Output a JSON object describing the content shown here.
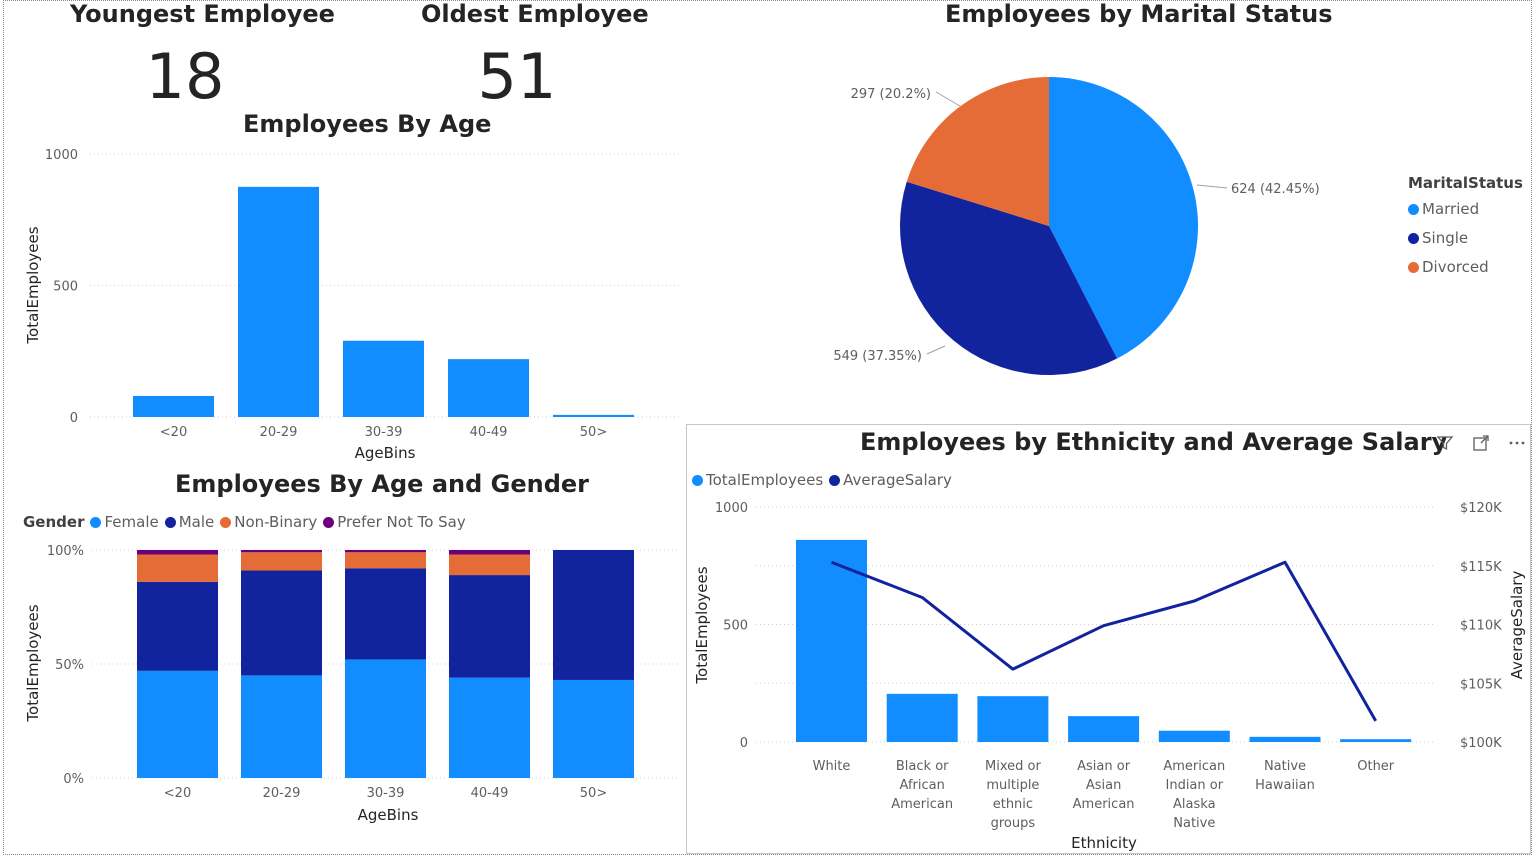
{
  "cards": [
    {
      "label": "Youngest Employee",
      "value": "18"
    },
    {
      "label": "Oldest Employee",
      "value": "51"
    }
  ],
  "charts": {
    "age": {
      "title": "Employees By Age",
      "xlabel": "AgeBins",
      "ylabel": "TotalEmployees",
      "ticks": [
        "0",
        "500",
        "1000"
      ]
    },
    "gender": {
      "title": "Employees By Age and Gender",
      "legend_title": "Gender",
      "legend": [
        "Female",
        "Male",
        "Non-Binary",
        "Prefer Not To Say"
      ],
      "xlabel": "AgeBins",
      "ylabel": "TotalEmployees",
      "ticks": [
        "0%",
        "50%",
        "100%"
      ]
    },
    "marital": {
      "title": "Employees by Marital Status",
      "legend_title": "MaritalStatus",
      "legend": [
        "Married",
        "Single",
        "Divorced"
      ],
      "labels": [
        "624 (42.45%)",
        "549 (37.35%)",
        "297 (20.2%)"
      ]
    },
    "ethnicity": {
      "title": "Employees by Ethnicity and Average Salary",
      "legend": [
        "TotalEmployees",
        "AverageSalary"
      ],
      "xlabel": "Ethnicity",
      "ylabel_left": "TotalEmployees",
      "ylabel_right": "AverageSalary",
      "left_ticks": [
        "0",
        "500",
        "1000"
      ],
      "right_ticks": [
        "$100K",
        "$105K",
        "$110K",
        "$115K",
        "$120K"
      ],
      "category_lines": [
        [
          "White"
        ],
        [
          "Black or",
          "African",
          "American"
        ],
        [
          "Mixed or",
          "multiple",
          "ethnic",
          "groups"
        ],
        [
          "Asian or",
          "Asian",
          "American"
        ],
        [
          "American",
          "Indian or",
          "Alaska",
          "Native"
        ],
        [
          "Native",
          "Hawaiian"
        ],
        [
          "Other"
        ]
      ]
    }
  },
  "colors": {
    "blue": "#118DFF",
    "navy": "#12239E",
    "orange": "#E66C37",
    "purple": "#6B007B",
    "grid": "#d0d0d0",
    "axis_text": "#605e5c",
    "line": "#12239E"
  },
  "icons": [
    "filter-icon",
    "focus-mode-icon",
    "more-options-icon"
  ],
  "chart_data": [
    {
      "type": "bar",
      "title": "Employees By Age",
      "categories": [
        "<20",
        "20-29",
        "30-39",
        "40-49",
        "50>"
      ],
      "values": [
        80,
        875,
        290,
        220,
        8
      ],
      "xlabel": "AgeBins",
      "ylabel": "TotalEmployees",
      "ylim": [
        0,
        1000
      ],
      "grid": true
    },
    {
      "type": "bar",
      "stacked_percent": true,
      "title": "Employees By Age and Gender",
      "categories": [
        "<20",
        "20-29",
        "30-39",
        "40-49",
        "50>"
      ],
      "series": [
        {
          "name": "Female",
          "values": [
            47,
            45,
            52,
            44,
            43
          ]
        },
        {
          "name": "Male",
          "values": [
            39,
            46,
            40,
            45,
            57
          ]
        },
        {
          "name": "Non-Binary",
          "values": [
            12,
            8,
            7,
            9,
            0
          ]
        },
        {
          "name": "Prefer Not To Say",
          "values": [
            2,
            1,
            1,
            2,
            0
          ]
        }
      ],
      "xlabel": "AgeBins",
      "ylabel": "TotalEmployees",
      "ylim": [
        0,
        100
      ],
      "legend_position": "top-left",
      "grid": true
    },
    {
      "type": "pie",
      "title": "Employees by Marital Status",
      "categories": [
        "Married",
        "Single",
        "Divorced"
      ],
      "values": [
        624,
        549,
        297
      ],
      "percents": [
        42.45,
        37.35,
        20.2
      ],
      "legend_position": "right"
    },
    {
      "type": "bar",
      "combo_line": true,
      "title": "Employees by Ethnicity and Average Salary",
      "categories": [
        "White",
        "Black or African American",
        "Mixed or multiple ethnic groups",
        "Asian or Asian American",
        "American Indian or Alaska Native",
        "Native Hawaiian",
        "Other"
      ],
      "series": [
        {
          "name": "TotalEmployees",
          "type": "bar",
          "axis": "left",
          "values": [
            860,
            205,
            195,
            110,
            48,
            22,
            12
          ]
        },
        {
          "name": "AverageSalary",
          "type": "line",
          "axis": "right",
          "values": [
            115300,
            112300,
            106200,
            109900,
            112000,
            115300,
            101800
          ]
        }
      ],
      "xlabel": "Ethnicity",
      "ylabel_left": "TotalEmployees",
      "ylabel_right": "AverageSalary",
      "ylim_left": [
        0,
        1000
      ],
      "ylim_right": [
        100000,
        120000
      ],
      "legend_position": "top-left",
      "grid": true
    }
  ]
}
